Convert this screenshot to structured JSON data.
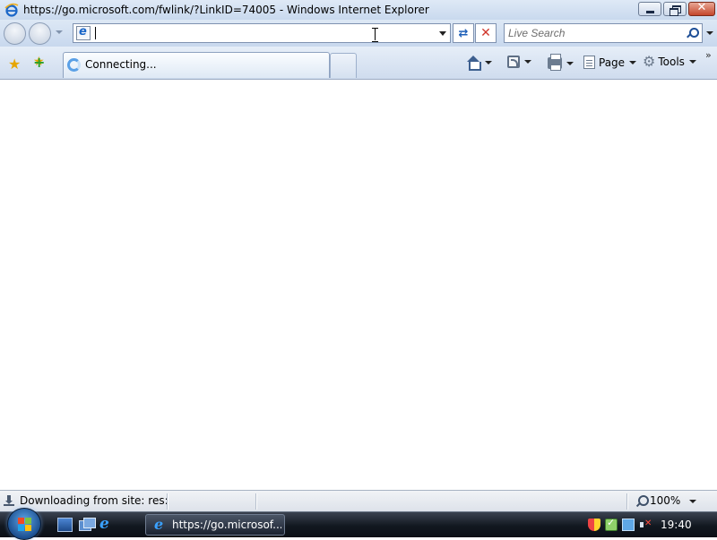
{
  "window": {
    "title": "https://go.microsoft.com/fwlink/?LinkID=74005 - Windows Internet Explorer",
    "caption_buttons": {
      "minimize": "minimize",
      "maximize": "maximize",
      "close": "✕"
    }
  },
  "navbar": {
    "address_value": "",
    "refresh_glyph": "⇄",
    "stop_glyph": "✕",
    "search_placeholder": "Live Search"
  },
  "cmdbar": {
    "tab_label": "Connecting...",
    "page_label": "Page",
    "tools_label": "Tools",
    "chevron": "»"
  },
  "statusbar": {
    "text": "Downloading from site: res://ie",
    "zoom": "100%"
  },
  "taskbar": {
    "task_label": "https://go.microsof...",
    "clock": "19:40"
  },
  "colors": {
    "chrome_top": "#dfe9f6",
    "chrome_bottom": "#c9d9ee",
    "taskbar": "#121820",
    "close_button": "#c4452b",
    "ie_blue": "#1a66c8"
  },
  "icons": [
    "ie-icon",
    "back-icon",
    "forward-icon",
    "refresh-icon",
    "stop-icon",
    "search-icon",
    "favorites-star-icon",
    "add-favorite-icon",
    "loading-icon",
    "home-icon",
    "feeds-icon",
    "print-icon",
    "page-icon",
    "gear-icon",
    "chevron-icon",
    "download-icon",
    "zoom-icon",
    "windows-logo-icon",
    "show-desktop-icon",
    "switch-windows-icon",
    "security-shield-icon",
    "health-icon",
    "network-icon",
    "volume-muted-icon"
  ]
}
